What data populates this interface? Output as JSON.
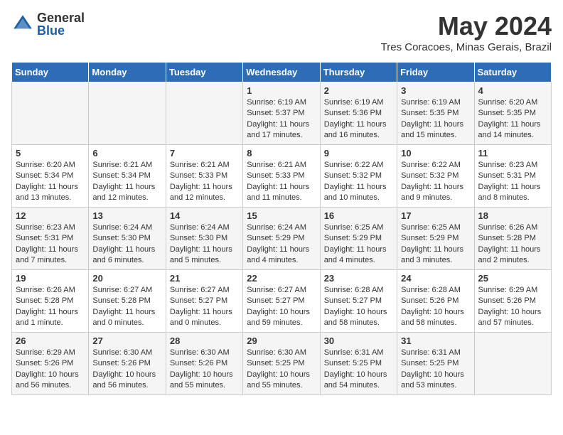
{
  "header": {
    "logo_general": "General",
    "logo_blue": "Blue",
    "title": "May 2024",
    "subtitle": "Tres Coracoes, Minas Gerais, Brazil"
  },
  "days_of_week": [
    "Sunday",
    "Monday",
    "Tuesday",
    "Wednesday",
    "Thursday",
    "Friday",
    "Saturday"
  ],
  "weeks": [
    [
      {
        "day": "",
        "info": ""
      },
      {
        "day": "",
        "info": ""
      },
      {
        "day": "",
        "info": ""
      },
      {
        "day": "1",
        "info": "Sunrise: 6:19 AM\nSunset: 5:37 PM\nDaylight: 11 hours and 17 minutes."
      },
      {
        "day": "2",
        "info": "Sunrise: 6:19 AM\nSunset: 5:36 PM\nDaylight: 11 hours and 16 minutes."
      },
      {
        "day": "3",
        "info": "Sunrise: 6:19 AM\nSunset: 5:35 PM\nDaylight: 11 hours and 15 minutes."
      },
      {
        "day": "4",
        "info": "Sunrise: 6:20 AM\nSunset: 5:35 PM\nDaylight: 11 hours and 14 minutes."
      }
    ],
    [
      {
        "day": "5",
        "info": "Sunrise: 6:20 AM\nSunset: 5:34 PM\nDaylight: 11 hours and 13 minutes."
      },
      {
        "day": "6",
        "info": "Sunrise: 6:21 AM\nSunset: 5:34 PM\nDaylight: 11 hours and 12 minutes."
      },
      {
        "day": "7",
        "info": "Sunrise: 6:21 AM\nSunset: 5:33 PM\nDaylight: 11 hours and 12 minutes."
      },
      {
        "day": "8",
        "info": "Sunrise: 6:21 AM\nSunset: 5:33 PM\nDaylight: 11 hours and 11 minutes."
      },
      {
        "day": "9",
        "info": "Sunrise: 6:22 AM\nSunset: 5:32 PM\nDaylight: 11 hours and 10 minutes."
      },
      {
        "day": "10",
        "info": "Sunrise: 6:22 AM\nSunset: 5:32 PM\nDaylight: 11 hours and 9 minutes."
      },
      {
        "day": "11",
        "info": "Sunrise: 6:23 AM\nSunset: 5:31 PM\nDaylight: 11 hours and 8 minutes."
      }
    ],
    [
      {
        "day": "12",
        "info": "Sunrise: 6:23 AM\nSunset: 5:31 PM\nDaylight: 11 hours and 7 minutes."
      },
      {
        "day": "13",
        "info": "Sunrise: 6:24 AM\nSunset: 5:30 PM\nDaylight: 11 hours and 6 minutes."
      },
      {
        "day": "14",
        "info": "Sunrise: 6:24 AM\nSunset: 5:30 PM\nDaylight: 11 hours and 5 minutes."
      },
      {
        "day": "15",
        "info": "Sunrise: 6:24 AM\nSunset: 5:29 PM\nDaylight: 11 hours and 4 minutes."
      },
      {
        "day": "16",
        "info": "Sunrise: 6:25 AM\nSunset: 5:29 PM\nDaylight: 11 hours and 4 minutes."
      },
      {
        "day": "17",
        "info": "Sunrise: 6:25 AM\nSunset: 5:29 PM\nDaylight: 11 hours and 3 minutes."
      },
      {
        "day": "18",
        "info": "Sunrise: 6:26 AM\nSunset: 5:28 PM\nDaylight: 11 hours and 2 minutes."
      }
    ],
    [
      {
        "day": "19",
        "info": "Sunrise: 6:26 AM\nSunset: 5:28 PM\nDaylight: 11 hours and 1 minute."
      },
      {
        "day": "20",
        "info": "Sunrise: 6:27 AM\nSunset: 5:28 PM\nDaylight: 11 hours and 0 minutes."
      },
      {
        "day": "21",
        "info": "Sunrise: 6:27 AM\nSunset: 5:27 PM\nDaylight: 11 hours and 0 minutes."
      },
      {
        "day": "22",
        "info": "Sunrise: 6:27 AM\nSunset: 5:27 PM\nDaylight: 10 hours and 59 minutes."
      },
      {
        "day": "23",
        "info": "Sunrise: 6:28 AM\nSunset: 5:27 PM\nDaylight: 10 hours and 58 minutes."
      },
      {
        "day": "24",
        "info": "Sunrise: 6:28 AM\nSunset: 5:26 PM\nDaylight: 10 hours and 58 minutes."
      },
      {
        "day": "25",
        "info": "Sunrise: 6:29 AM\nSunset: 5:26 PM\nDaylight: 10 hours and 57 minutes."
      }
    ],
    [
      {
        "day": "26",
        "info": "Sunrise: 6:29 AM\nSunset: 5:26 PM\nDaylight: 10 hours and 56 minutes."
      },
      {
        "day": "27",
        "info": "Sunrise: 6:30 AM\nSunset: 5:26 PM\nDaylight: 10 hours and 56 minutes."
      },
      {
        "day": "28",
        "info": "Sunrise: 6:30 AM\nSunset: 5:26 PM\nDaylight: 10 hours and 55 minutes."
      },
      {
        "day": "29",
        "info": "Sunrise: 6:30 AM\nSunset: 5:25 PM\nDaylight: 10 hours and 55 minutes."
      },
      {
        "day": "30",
        "info": "Sunrise: 6:31 AM\nSunset: 5:25 PM\nDaylight: 10 hours and 54 minutes."
      },
      {
        "day": "31",
        "info": "Sunrise: 6:31 AM\nSunset: 5:25 PM\nDaylight: 10 hours and 53 minutes."
      },
      {
        "day": "",
        "info": ""
      }
    ]
  ]
}
